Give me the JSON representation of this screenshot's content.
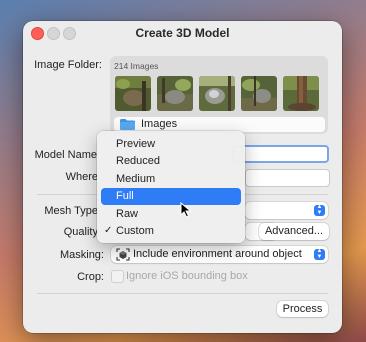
{
  "window": {
    "title": "Create 3D Model"
  },
  "image_folder": {
    "label": "Image Folder:",
    "image_count": "214 Images",
    "folder_name": "Images"
  },
  "model_name": {
    "label": "Model Name",
    "value": ""
  },
  "where": {
    "label": "Where",
    "value": ""
  },
  "mesh_type": {
    "label": "Mesh Type"
  },
  "quality": {
    "label": "Quality",
    "advanced_button": "Advanced...",
    "menu": {
      "items": [
        {
          "label": "Preview"
        },
        {
          "label": "Reduced"
        },
        {
          "label": "Medium"
        },
        {
          "label": "Full"
        },
        {
          "label": "Raw"
        },
        {
          "label": "Custom"
        }
      ],
      "highlighted": "Full",
      "checked": "Custom",
      "check_mark": "✓"
    }
  },
  "masking": {
    "label": "Masking:",
    "value": "Include environment around object"
  },
  "crop": {
    "label": "Crop:",
    "checkbox_label": "Ignore iOS bounding box",
    "checked": false
  },
  "process_button": "Process",
  "colors": {
    "accent": "#2e7cf6",
    "close": "#fe5f57",
    "focus_ring": "#7aa7e8"
  }
}
